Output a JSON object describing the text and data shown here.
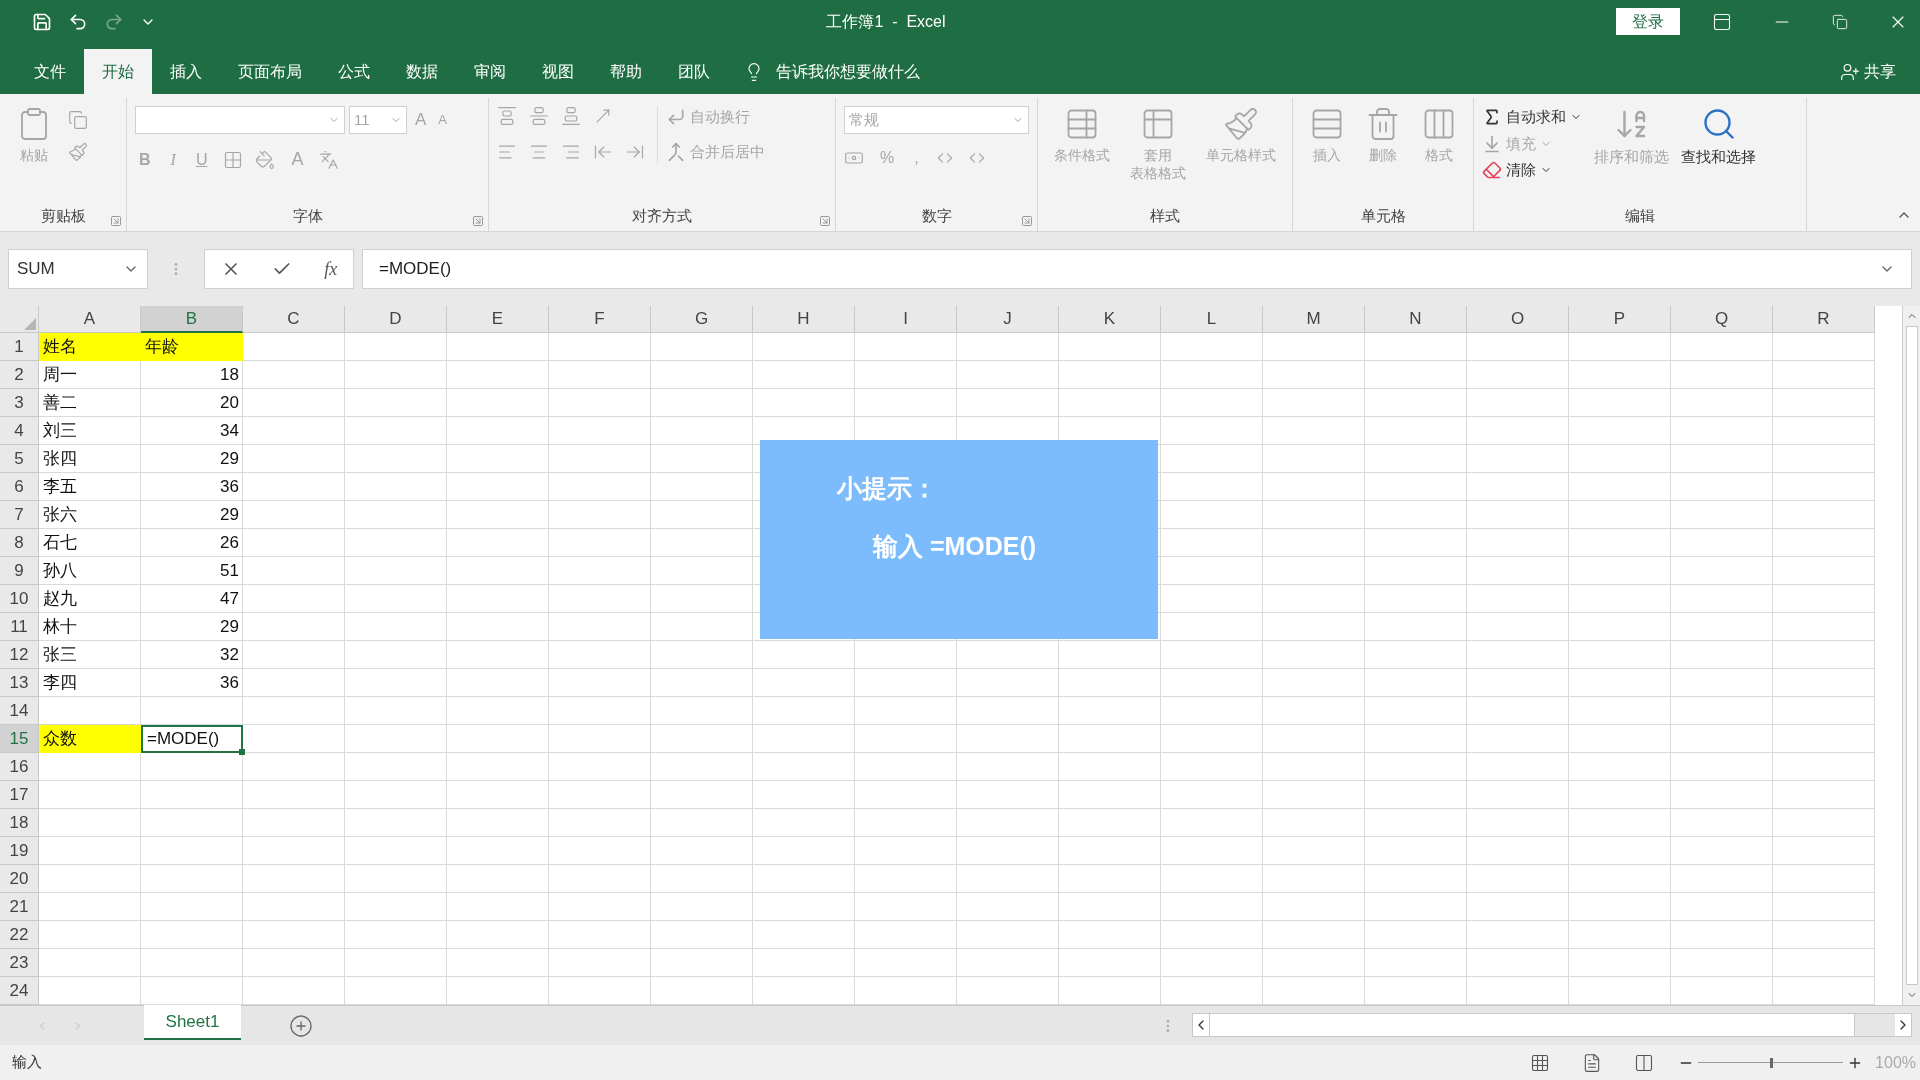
{
  "window": {
    "title": "工作簿1  -  Excel",
    "sign_in": "登录"
  },
  "menu_tabs": [
    {
      "label": "文件",
      "selected": false
    },
    {
      "label": "开始",
      "selected": true
    },
    {
      "label": "插入",
      "selected": false
    },
    {
      "label": "页面布局",
      "selected": false
    },
    {
      "label": "公式",
      "selected": false
    },
    {
      "label": "数据",
      "selected": false
    },
    {
      "label": "审阅",
      "selected": false
    },
    {
      "label": "视图",
      "selected": false
    },
    {
      "label": "帮助",
      "selected": false
    },
    {
      "label": "团队",
      "selected": false
    }
  ],
  "tell_me": "告诉我你想要做什么",
  "share": "共享",
  "ribbon": {
    "groups": [
      {
        "title": "剪贴板",
        "kind": "clipboard",
        "launcher": true,
        "buttons": [
          {
            "lines": [
              "粘贴"
            ],
            "disabled": true
          }
        ]
      },
      {
        "title": "字体",
        "kind": "font",
        "launcher": true,
        "font_size": "11",
        "grow": "A",
        "shrink": "A",
        "styles": [
          "B",
          "I",
          "U"
        ],
        "font_color": "A"
      },
      {
        "title": "对齐方式",
        "kind": "alignment",
        "launcher": true,
        "buttons": [
          {
            "lines": [
              "自动换行"
            ],
            "disabled": true
          },
          {
            "lines": [
              "合并后居中"
            ],
            "disabled": true
          }
        ]
      },
      {
        "title": "数字",
        "kind": "number",
        "launcher": true,
        "format": "常规",
        "symbols": [
          "%",
          ","
        ]
      },
      {
        "title": "样式",
        "kind": "styles",
        "launcher": false,
        "buttons": [
          {
            "lines": [
              "条件格式"
            ],
            "disabled": true
          },
          {
            "lines": [
              "套用",
              "表格格式"
            ],
            "disabled": true
          },
          {
            "lines": [
              "单元格样式"
            ],
            "disabled": true
          }
        ]
      },
      {
        "title": "单元格",
        "kind": "cells",
        "launcher": false,
        "buttons": [
          {
            "lines": [
              "插入"
            ],
            "disabled": true
          },
          {
            "lines": [
              "删除"
            ],
            "disabled": true
          },
          {
            "lines": [
              "格式"
            ],
            "disabled": true
          }
        ]
      },
      {
        "title": "编辑",
        "kind": "editing",
        "launcher": false,
        "buttons": [
          {
            "kind": "small",
            "lines": [
              "自动求和"
            ],
            "disabled": false
          },
          {
            "kind": "small",
            "lines": [
              "填充"
            ],
            "disabled": true
          },
          {
            "kind": "small",
            "lines": [
              "清除"
            ],
            "disabled": false
          },
          {
            "kind": "large",
            "lines": [
              "排序和筛选"
            ],
            "disabled": true
          },
          {
            "kind": "large",
            "lines": [
              "查找和选择"
            ],
            "disabled": false
          }
        ]
      }
    ]
  },
  "formula_bar": {
    "name_box": "SUM",
    "fx": "fx",
    "formula": "=MODE()"
  },
  "columns": [
    {
      "label": "A",
      "selected": false
    },
    {
      "label": "B",
      "selected": true
    },
    {
      "label": "C",
      "selected": false
    },
    {
      "label": "D",
      "selected": false
    },
    {
      "label": "E",
      "selected": false
    },
    {
      "label": "F",
      "selected": false
    },
    {
      "label": "G",
      "selected": false
    },
    {
      "label": "H",
      "selected": false
    },
    {
      "label": "I",
      "selected": false
    },
    {
      "label": "J",
      "selected": false
    },
    {
      "label": "K",
      "selected": false
    },
    {
      "label": "L",
      "selected": false
    },
    {
      "label": "M",
      "selected": false
    },
    {
      "label": "N",
      "selected": false
    },
    {
      "label": "O",
      "selected": false
    },
    {
      "label": "P",
      "selected": false
    },
    {
      "label": "Q",
      "selected": false
    },
    {
      "label": "R",
      "selected": false
    }
  ],
  "rows": [
    {
      "number": "1",
      "selected": false,
      "cells": [
        {
          "text": "姓名",
          "kind": "text",
          "color": "#ffff00",
          "selected": false
        },
        {
          "text": "年龄",
          "kind": "text",
          "color": "#ffff00",
          "selected": false
        }
      ]
    },
    {
      "number": "2",
      "selected": false,
      "cells": [
        {
          "text": "周一",
          "kind": "text",
          "selected": false
        },
        {
          "text": "18",
          "kind": "number",
          "selected": false
        }
      ]
    },
    {
      "number": "3",
      "selected": false,
      "cells": [
        {
          "text": "善二",
          "kind": "text",
          "selected": false
        },
        {
          "text": "20",
          "kind": "number",
          "selected": false
        }
      ]
    },
    {
      "number": "4",
      "selected": false,
      "cells": [
        {
          "text": "刘三",
          "kind": "text",
          "selected": false
        },
        {
          "text": "34",
          "kind": "number",
          "selected": false
        }
      ]
    },
    {
      "number": "5",
      "selected": false,
      "cells": [
        {
          "text": "张四",
          "kind": "text",
          "selected": false
        },
        {
          "text": "29",
          "kind": "number",
          "selected": false
        }
      ]
    },
    {
      "number": "6",
      "selected": false,
      "cells": [
        {
          "text": "李五",
          "kind": "text",
          "selected": false
        },
        {
          "text": "36",
          "kind": "number",
          "selected": false
        }
      ]
    },
    {
      "number": "7",
      "selected": false,
      "cells": [
        {
          "text": "张六",
          "kind": "text",
          "selected": false
        },
        {
          "text": "29",
          "kind": "number",
          "selected": false
        }
      ]
    },
    {
      "number": "8",
      "selected": false,
      "cells": [
        {
          "text": "石七",
          "kind": "text",
          "selected": false
        },
        {
          "text": "26",
          "kind": "number",
          "selected": false
        }
      ]
    },
    {
      "number": "9",
      "selected": false,
      "cells": [
        {
          "text": "孙八",
          "kind": "text",
          "selected": false
        },
        {
          "text": "51",
          "kind": "number",
          "selected": false
        }
      ]
    },
    {
      "number": "10",
      "selected": false,
      "cells": [
        {
          "text": "赵九",
          "kind": "text",
          "selected": false
        },
        {
          "text": "47",
          "kind": "number",
          "selected": false
        }
      ]
    },
    {
      "number": "11",
      "selected": false,
      "cells": [
        {
          "text": "林十",
          "kind": "text",
          "selected": false
        },
        {
          "text": "29",
          "kind": "number",
          "selected": false
        }
      ]
    },
    {
      "number": "12",
      "selected": false,
      "cells": [
        {
          "text": "张三",
          "kind": "text",
          "selected": false
        },
        {
          "text": "32",
          "kind": "number",
          "selected": false
        }
      ]
    },
    {
      "number": "13",
      "selected": false,
      "cells": [
        {
          "text": "李四",
          "kind": "text",
          "selected": false
        },
        {
          "text": "36",
          "kind": "number",
          "selected": false
        }
      ]
    },
    {
      "number": "14",
      "selected": false
    },
    {
      "number": "15",
      "selected": true,
      "cells": [
        {
          "text": "众数",
          "kind": "text",
          "color": "#ffff00",
          "selected": false
        },
        {
          "text": "=MODE()",
          "kind": "text",
          "selected": true
        }
      ]
    },
    {
      "number": "16",
      "selected": false
    },
    {
      "number": "17",
      "selected": false
    },
    {
      "number": "18",
      "selected": false
    },
    {
      "number": "19",
      "selected": false
    },
    {
      "number": "20",
      "selected": false
    },
    {
      "number": "21",
      "selected": false
    },
    {
      "number": "22",
      "selected": false
    },
    {
      "number": "23",
      "selected": false
    },
    {
      "number": "24",
      "selected": false
    }
  ],
  "tip": {
    "title": "小提示：",
    "body": "输入 =MODE()"
  },
  "sheets": [
    {
      "label": "Sheet1",
      "selected": true
    }
  ],
  "status_bar": {
    "mode": "输入",
    "zoom": {
      "level": 0.5,
      "reading": "100%"
    }
  }
}
